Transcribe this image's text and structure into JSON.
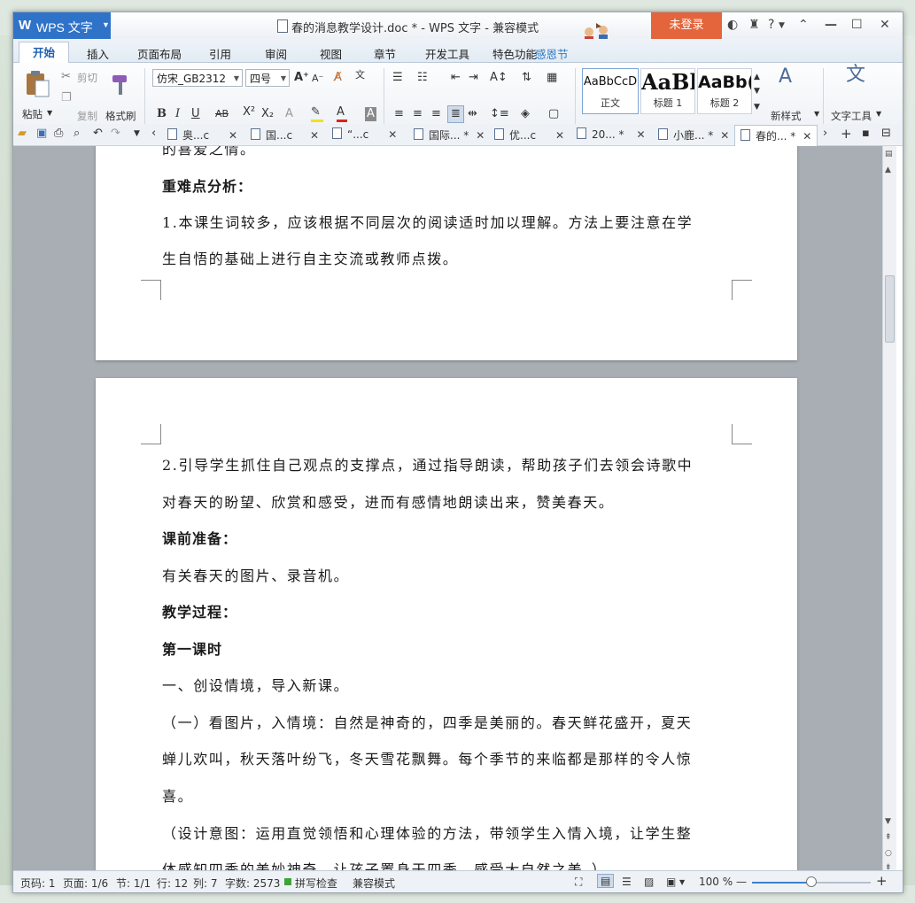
{
  "app": {
    "name": "WPS 文字",
    "logo": "W",
    "document_title": "春的消息教学设计.doc * - WPS 文字 - 兼容模式",
    "login_button": "未登录",
    "help_label": "?"
  },
  "menu_tabs": [
    "开始",
    "插入",
    "页面布局",
    "引用",
    "审阅",
    "视图",
    "章节",
    "开发工具",
    "特色功能",
    "感恩节"
  ],
  "ribbon": {
    "paste": "粘贴",
    "cut": "剪切",
    "copy": "复制",
    "format_painter": "格式刷",
    "font_name": "仿宋_GB2312",
    "font_size": "四号",
    "styles": [
      {
        "preview": "AaBbCcD",
        "label": "正文"
      },
      {
        "preview": "AaBl",
        "label": "标题 1"
      },
      {
        "preview": "AaBb(",
        "label": "标题 2"
      }
    ],
    "new_style": "新样式",
    "text_tools": "文字工具",
    "colors": {
      "accent": "#2f73c9",
      "login": "#e4653b",
      "font_color": "#d9241b",
      "highlight": "#f4e01c"
    }
  },
  "doc_tabs": [
    {
      "label": "奥...c",
      "active": false
    },
    {
      "label": "国...c",
      "active": false
    },
    {
      "label": "“...c",
      "active": false
    },
    {
      "label": "国际... *",
      "active": false
    },
    {
      "label": "优...c",
      "active": false
    },
    {
      "label": "20... *",
      "active": false
    },
    {
      "label": "小鹿... *",
      "active": false
    },
    {
      "label": "春的... *",
      "active": true
    }
  ],
  "page1": {
    "lines": [
      "的喜爱之情。",
      "重难点分析：",
      "1.本课生词较多，应该根据不同层次的阅读适时加以理解。方法上要注意在学",
      "生自悟的基础上进行自主交流或教师点拨。"
    ]
  },
  "page2": {
    "lines": [
      "2.引导学生抓住自己观点的支撑点，通过指导朗读，帮助孩子们去领会诗歌中",
      "对春天的盼望、欣赏和感受，进而有感情地朗读出来，赞美春天。",
      "课前准备：",
      "有关春天的图片、录音机。",
      "教学过程：",
      "第一课时",
      "一、创设情境，导入新课。",
      "（一）看图片，入情境：自然是神奇的，四季是美丽的。春天鲜花盛开，夏天",
      "蝉儿欢叫，秋天落叶纷飞，冬天雪花飘舞。每个季节的来临都是那样的令人惊",
      "喜。",
      "（设计意图：运用直觉领悟和心理体验的方法，带领学生入情入境，让学生整",
      "体感知四季的美妙神奇，让孩子置身于四季，感受大自然之美。）"
    ]
  },
  "status": {
    "page_code": "页码: 1",
    "pages": "页面: 1/6",
    "section": "节: 1/1",
    "row": "行: 12",
    "col": "列: 7",
    "word_count": "字数: 2573",
    "spellcheck": "拼写检查",
    "compat": "兼容模式",
    "zoom": "100 %",
    "zoom_fraction": 0.5
  }
}
